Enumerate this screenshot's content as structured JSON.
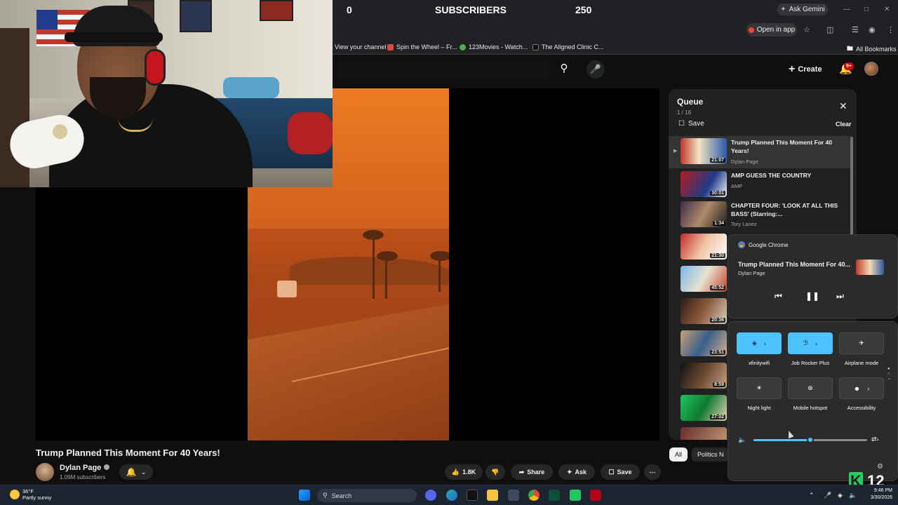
{
  "overlay": {
    "subs_left": "0",
    "subs_label": "SUBSCRIBERS",
    "subs_right": "250"
  },
  "browser": {
    "gemini_label": "Ask Gemini",
    "open_in_app": "Open in app",
    "bookmarks": [
      "View your channel",
      "Spin the Wheel – Fr...",
      "123Movies - Watch...",
      "The Aligned Clinic C..."
    ],
    "all_bookmarks": "All Bookmarks"
  },
  "yt_header": {
    "create_label": "Create",
    "notif_count": "9+"
  },
  "video": {
    "title": "Trump Planned This Moment For 40 Years!",
    "channel": "Dylan Page",
    "subscribers": "1.09M subscribers",
    "likes": "1.8K",
    "share_label": "Share",
    "ask_label": "Ask",
    "save_label": "Save"
  },
  "queue": {
    "title": "Queue",
    "count": "1 / 16",
    "save_label": "Save",
    "clear_label": "Clear",
    "items": [
      {
        "title": "Trump Planned This Moment For 40 Years!",
        "channel": "Dylan Page",
        "duration": "21:07"
      },
      {
        "title": "AMP GUESS THE COUNTRY",
        "channel": "AMP",
        "duration": "30:01"
      },
      {
        "title": "CHAPTER FOUR: 'LOOK AT ALL THIS BASS' (Starring:...",
        "channel": "Tory Lanez",
        "duration": "1:34"
      },
      {
        "duration": "21:30"
      },
      {
        "duration": "45:52"
      },
      {
        "duration": "20:36"
      },
      {
        "duration": "23:51"
      },
      {
        "duration": "8:59"
      },
      {
        "duration": "27:02"
      }
    ]
  },
  "media_flyout": {
    "app": "Google Chrome",
    "title": "Trump Planned This Moment For 40...",
    "artist": "Dylan Page"
  },
  "quick_settings": {
    "tiles": [
      {
        "label": "xfinitywifi",
        "on": true
      },
      {
        "label": "Job Rocker Plus",
        "on": true
      },
      {
        "label": "Airplane mode",
        "on": false
      },
      {
        "label": "Night light",
        "on": false
      },
      {
        "label": "Mobile hotspot",
        "on": false
      },
      {
        "label": "Accessibility",
        "on": false
      }
    ],
    "volume_fraction": 0.5
  },
  "chips": {
    "all": "All",
    "politics": "Politics N"
  },
  "taskbar": {
    "temp": "36°F",
    "weather": "Partly sunny",
    "search": "Search",
    "time": "9:46 PM",
    "date": "3/30/2026"
  },
  "watermark": "12"
}
